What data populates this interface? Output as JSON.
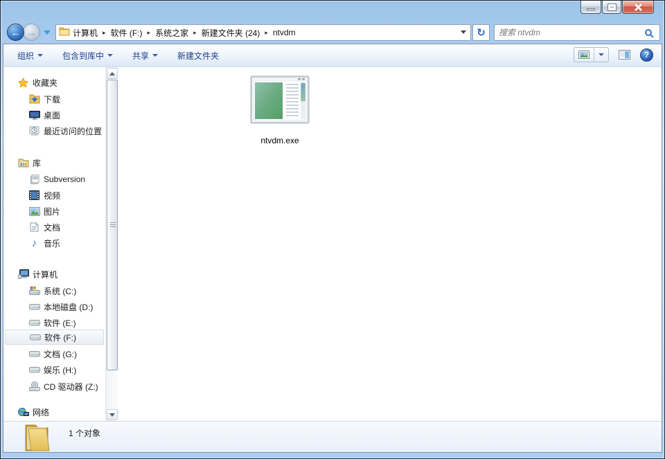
{
  "nav": {
    "breadcrumb": [
      "计算机",
      "软件 (F:)",
      "系统之家",
      "新建文件夹 (24)",
      "ntvdm"
    ],
    "crumb_separator": "▸",
    "search_placeholder": "搜索 ntvdm"
  },
  "toolbar": {
    "organize_label": "组织",
    "include_label": "包含到库中",
    "share_label": "共享",
    "new_folder_label": "新建文件夹"
  },
  "sidebar": {
    "favorites_label": "收藏夹",
    "favorites_items": [
      "下载",
      "桌面",
      "最近访问的位置"
    ],
    "libraries_label": "库",
    "libraries_items": [
      "Subversion",
      "视频",
      "图片",
      "文档",
      "音乐"
    ],
    "computer_label": "计算机",
    "computer_items": [
      "系统 (C:)",
      "本地磁盘 (D:)",
      "软件 (E:)",
      "软件 (F:)",
      "文档 (G:)",
      "娱乐 (H:)",
      "CD 驱动器 (Z:)"
    ],
    "network_label": "网络",
    "selected_item": "软件 (F:)"
  },
  "content": {
    "files": [
      {
        "name": "ntvdm.exe"
      }
    ]
  },
  "statusbar": {
    "item_count": "1 个对象"
  },
  "glyphs": {
    "back": "←",
    "forward": "→",
    "refresh": "↻",
    "music_note": "♪",
    "help": "?"
  },
  "colors": {
    "titlebar_glass": "#bad8fa",
    "toolbar_text": "#1e3c87",
    "close_red": "#ce5747",
    "selection_border": "#d4dbe3"
  }
}
